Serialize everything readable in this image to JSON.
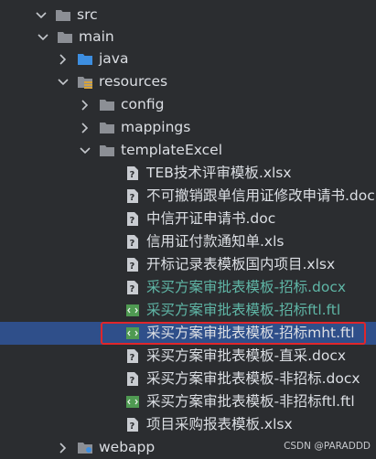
{
  "tree": {
    "src": "src",
    "main": "main",
    "java": "java",
    "resources": "resources",
    "config": "config",
    "mappings": "mappings",
    "templateExcel": "templateExcel",
    "files": [
      {
        "name": "TEB技术评审模板.xlsx",
        "icon": "xlsx-file-icon",
        "color": "default"
      },
      {
        "name": "不可撤销跟单信用证修改申请书.doc",
        "icon": "doc-file-icon",
        "color": "default"
      },
      {
        "name": "中信开证申请书.doc",
        "icon": "doc-file-icon",
        "color": "default"
      },
      {
        "name": "信用证付款通知单.xls",
        "icon": "xls-file-icon",
        "color": "default"
      },
      {
        "name": "开标记录表模板国内项目.xlsx",
        "icon": "xlsx-file-icon",
        "color": "default"
      },
      {
        "name": "采买方案审批表模板-招标.docx",
        "icon": "docx-file-icon",
        "color": "teal"
      },
      {
        "name": "采买方案审批表模板-招标ftl.ftl",
        "icon": "ftl-file-icon",
        "color": "teal"
      },
      {
        "name": "采买方案审批表模板-招标mht.ftl",
        "icon": "ftl-file-icon",
        "color": "default",
        "selected": true
      },
      {
        "name": "采买方案审批表模板-直采.docx",
        "icon": "docx-file-icon",
        "color": "default"
      },
      {
        "name": "采买方案审批表模板-非招标.docx",
        "icon": "docx-file-icon",
        "color": "default"
      },
      {
        "name": "采买方案审批表模板-非招标ftl.ftl",
        "icon": "ftl-file-icon",
        "color": "default"
      },
      {
        "name": "项目采购报表模板.xlsx",
        "icon": "xlsx-file-icon",
        "color": "default"
      }
    ],
    "webapp": "webapp"
  },
  "watermark": "CSDN @PARADDD",
  "colors": {
    "background": "#2b2d30",
    "selection": "#2f4f8a",
    "highlight_box": "#e0262b",
    "teal_text": "#5fb6a6",
    "folder": "#8c8f95"
  }
}
